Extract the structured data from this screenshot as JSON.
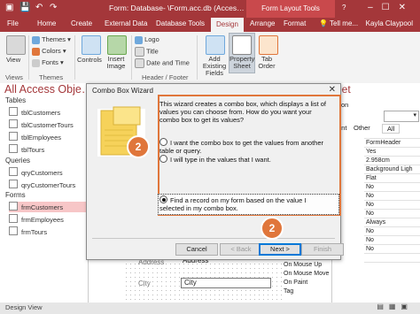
{
  "titlebar": {
    "title": "Form: Database- \\Form.acc.db (Acces…",
    "context_tools": "Form Layout Tools",
    "help": "?"
  },
  "tabs": {
    "file": "File",
    "home": "Home",
    "create": "Create",
    "external": "External Data",
    "dbtools": "Database Tools",
    "design": "Design",
    "arrange": "Arrange",
    "format": "Format",
    "tellme": "Tell me...",
    "user": "Kayla Claypool"
  },
  "ribbon": {
    "view": "View",
    "views_group": "Views",
    "themes": "Themes",
    "colors": "Colors",
    "fonts": "Fonts",
    "themes_group": "Themes",
    "controls": "Controls",
    "insert_image": "Insert Image",
    "logo": "Logo",
    "title": "Title",
    "date_time": "Date and Time",
    "header_footer_group": "Header / Footer",
    "add_existing": "Add Existing Fields",
    "property_sheet": "Property Sheet",
    "tab_order": "Tab Order"
  },
  "nav": {
    "title": "All Access Obje…",
    "sections": [
      {
        "label": "Tables",
        "items": [
          "tblCustomers",
          "tblCustomerTours",
          "tblEmployees",
          "tblTours"
        ]
      },
      {
        "label": "Queries",
        "items": [
          "qryCustomers",
          "qryCustomerTours"
        ]
      },
      {
        "label": "Forms",
        "items": [
          "frmCustomers",
          "frmEmployees",
          "frmTours"
        ]
      }
    ]
  },
  "property_sheet": {
    "title": "eet",
    "subtitle": "on",
    "tabs": [
      "ent",
      "Other",
      "All"
    ],
    "values": [
      "FormHeader",
      "Yes",
      "2.958cm",
      "Background Ligh",
      "Flat",
      "No",
      "No",
      "No",
      "No",
      "Always",
      "No",
      "No",
      "No"
    ]
  },
  "dialog": {
    "title": "Combo Box Wizard",
    "close": "✕",
    "intro": "This wizard creates a combo box, which displays a list of values you can choose from.  How do you want your combo box to get its values?",
    "options": [
      {
        "label": "I want the combo box to get the values from another table or query.",
        "selected": false
      },
      {
        "label": "I will type in the values that I want.",
        "selected": false
      },
      {
        "label": "Find a record on my form based on the value I selected in my combo box.",
        "selected": true
      }
    ],
    "buttons": {
      "cancel": "Cancel",
      "back": "< Back",
      "next": "Next >",
      "finish": "Finish"
    }
  },
  "badges": {
    "step_a": "2",
    "step_b": "2"
  },
  "form_peek": {
    "address_label": "Address",
    "city_label": "City",
    "ghost1": "Address",
    "ghost2": "City"
  },
  "events": [
    "On Mouse Up",
    "On Mouse Move",
    "On Paint",
    "Tag"
  ],
  "status": {
    "text": "Design View"
  },
  "colors": {
    "accent": "#a4373a",
    "callout": "#e0763b"
  }
}
